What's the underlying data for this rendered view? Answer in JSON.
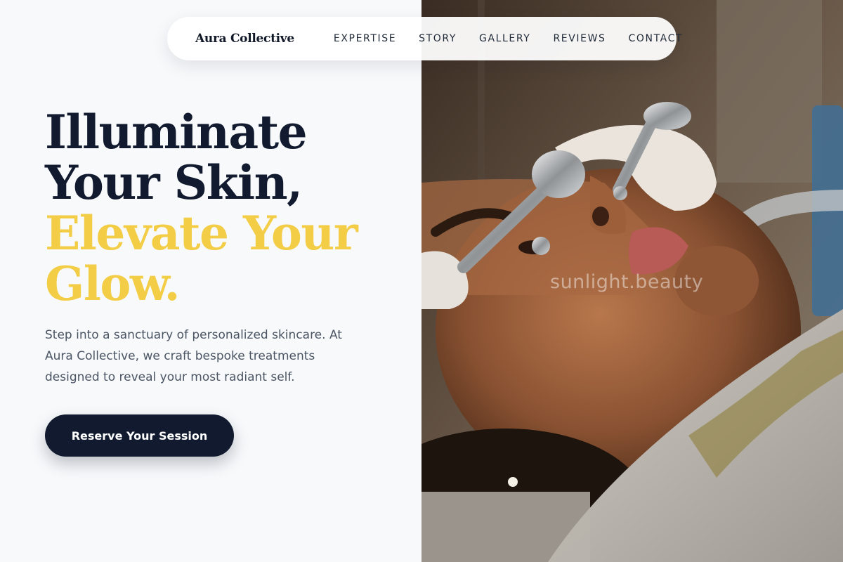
{
  "brand": {
    "name": "Aura Collective"
  },
  "nav": {
    "links": [
      {
        "label": "EXPERTISE"
      },
      {
        "label": "STORY"
      },
      {
        "label": "GALLERY"
      },
      {
        "label": "REVIEWS"
      },
      {
        "label": "CONTACT"
      }
    ]
  },
  "hero": {
    "title_lines": [
      "Illuminate",
      "Your Skin,"
    ],
    "accent_lines": [
      "Elevate Your",
      "Glow."
    ],
    "description": "Step into a sanctuary of personalized skincare. At Aura Collective, we craft bespoke treatments designed to reveal your most radiant self.",
    "cta_label": "Reserve Your Session"
  },
  "image": {
    "watermark": "sunlight.beauty"
  },
  "colors": {
    "navy": "#111a2e",
    "gold": "#f2cd45",
    "background": "#f7f9fb",
    "body_text": "#4b5563"
  }
}
